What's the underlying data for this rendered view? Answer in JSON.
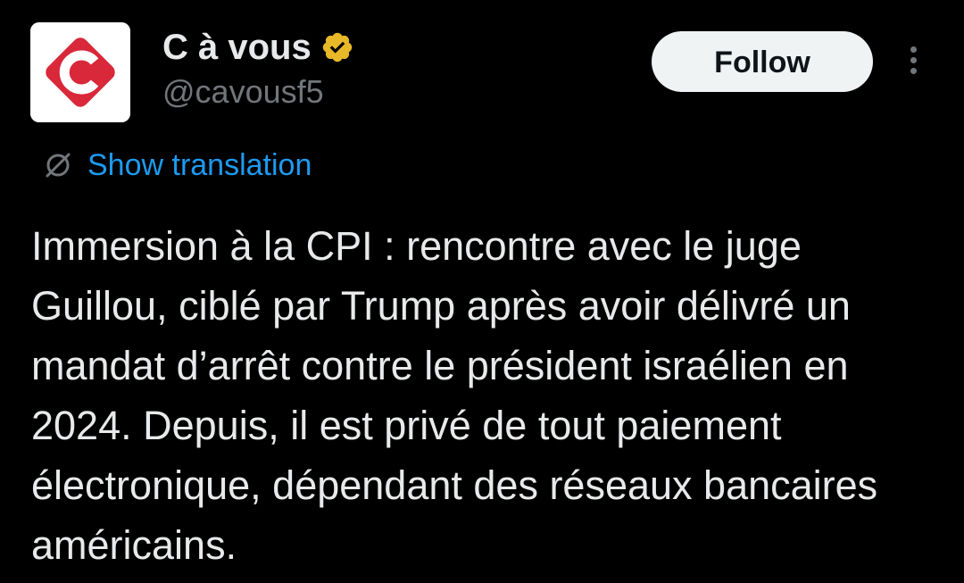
{
  "account": {
    "display_name": "C à vous",
    "handle": "@cavousf5",
    "verified_icon": "verified-badge-gold-icon",
    "avatar_letter": "C",
    "avatar_colors": {
      "diamond": "#d8283a",
      "background": "#ffffff",
      "letter": "#ffffff"
    }
  },
  "actions": {
    "follow_label": "Follow",
    "more_icon": "more-vertical-icon"
  },
  "translation": {
    "label": "Show translation",
    "icon": "globe-slash-icon"
  },
  "tweet": {
    "text": "Immersion à la CPI : rencontre avec le juge Guillou, ciblé par Trump après avoir délivré un mandat d’arrêt contre le président israélien en 2024. Depuis, il est privé de tout paiement électronique, dépendant des réseaux bancaires américains."
  },
  "colors": {
    "background": "#000000",
    "text_primary": "#e7e9ea",
    "text_secondary": "#71767b",
    "link": "#1d9bf0",
    "verified_gold": "#e8b829",
    "button_bg": "#eff3f4",
    "button_text": "#0f1419"
  }
}
